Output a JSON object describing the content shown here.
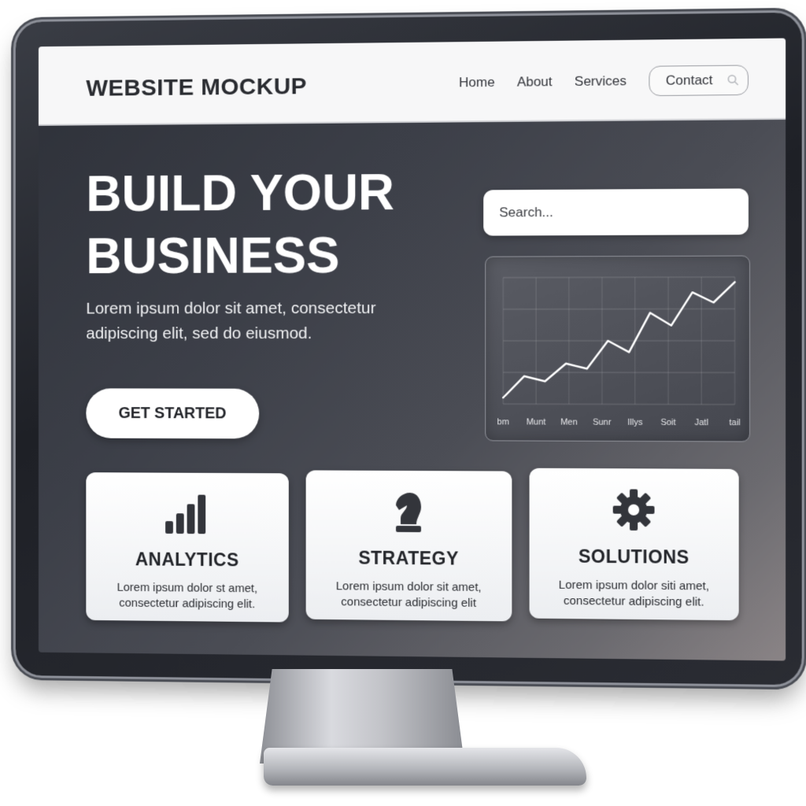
{
  "header": {
    "brand": "WEBSITE MOCKUP",
    "nav": [
      "Home",
      "About",
      "Services"
    ],
    "contact_label": "Contact",
    "contact_icon": "search-icon"
  },
  "hero": {
    "title_line1": "BUILD YOUR",
    "title_line2": "BUSINESS",
    "text": "Lorem ipsum dolor sit amet, consectetur adipiscing elit, sed do eiusmod.",
    "cta_label": "GET STARTED"
  },
  "search": {
    "placeholder": "Search..."
  },
  "chart_data": {
    "type": "line",
    "categories": [
      "bm",
      "Munt",
      "Men",
      "Sunr",
      "Illys",
      "Soit",
      "Jatl",
      "tail"
    ],
    "series": [
      {
        "values": [
          5,
          22,
          18,
          32,
          28,
          50,
          41,
          72,
          62,
          88,
          80,
          96
        ]
      }
    ],
    "ylim": [
      0,
      100
    ],
    "grid": true,
    "color": "#ffffff"
  },
  "cards": [
    {
      "icon": "bar-chart-icon",
      "title": "ANALYTICS",
      "desc": "Lorem ipsum dolor st amet, consectetur adipiscing elit."
    },
    {
      "icon": "chess-knight-icon",
      "title": "STRATEGY",
      "desc": "Lorem ipsum dolor  sit amet, consectetur adipiscing elit"
    },
    {
      "icon": "gear-icon",
      "title": "SOLUTIONS",
      "desc": "Lorem ipsum dolor siti amet, consectetur adipiscing elit."
    }
  ],
  "colors": {
    "screen_dark": "#2d3038",
    "card_bg": "#ffffff",
    "text_dark": "#23252a"
  }
}
